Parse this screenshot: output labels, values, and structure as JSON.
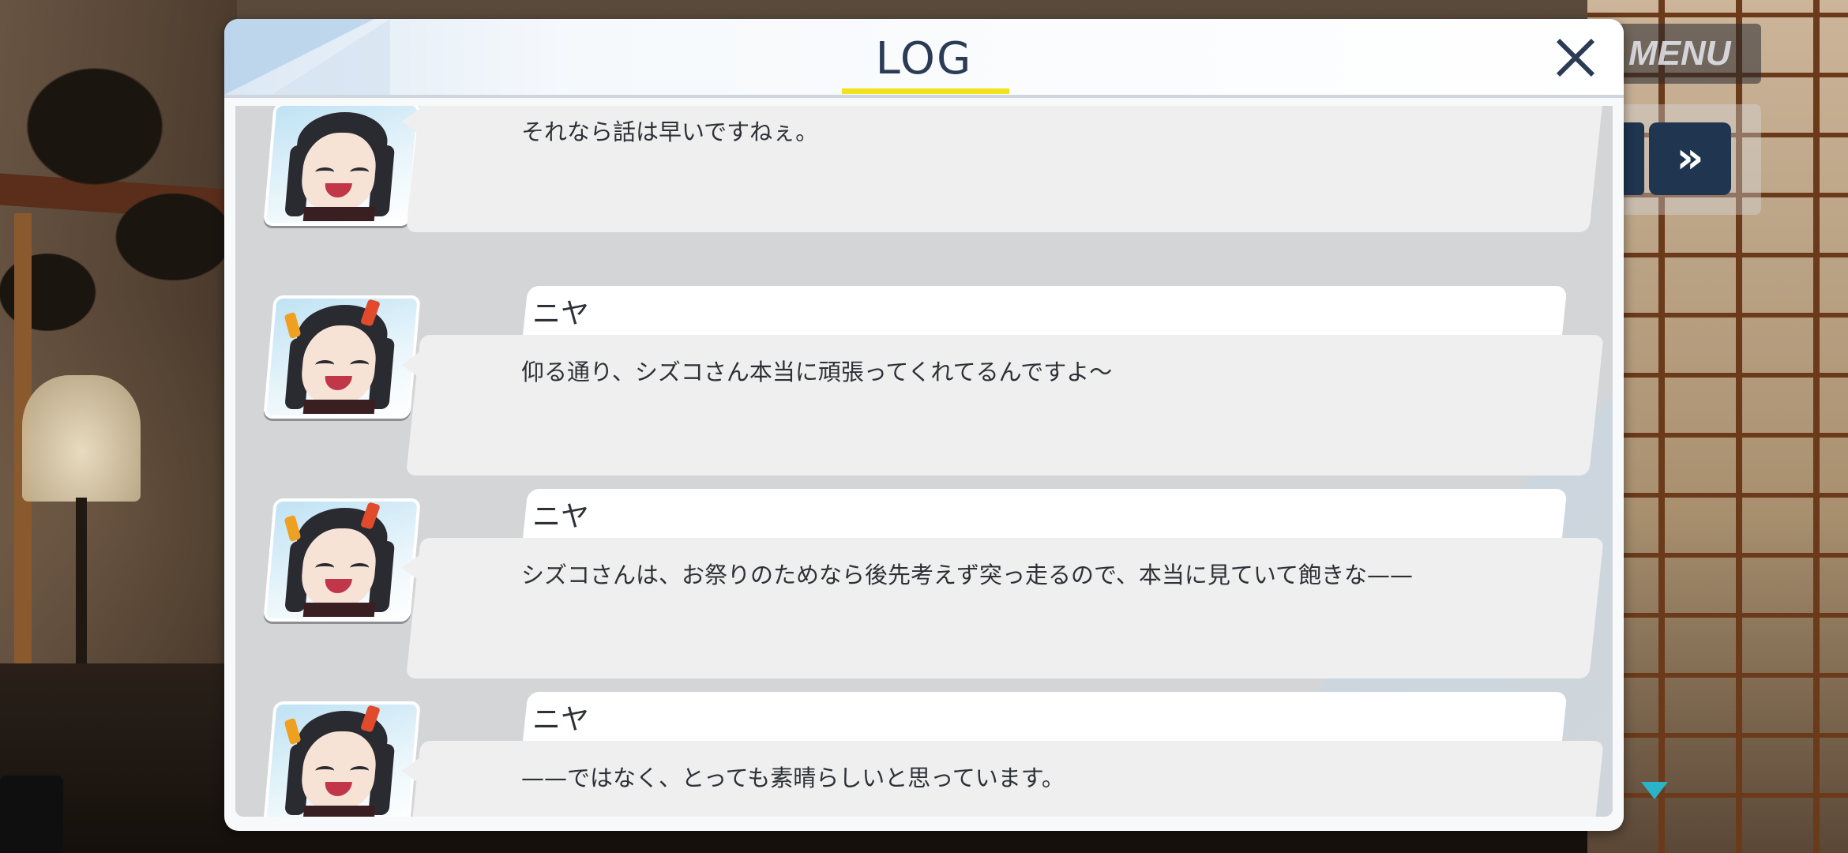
{
  "menu": {
    "label": "MENU"
  },
  "controls": {
    "skip_label": "»"
  },
  "log": {
    "title": "LOG",
    "accent_color": "#f1e21b",
    "close_icon": "close-icon",
    "entries": [
      {
        "speaker": "",
        "text": "それなら話は早いですねぇ。"
      },
      {
        "speaker": "ニヤ",
        "text": "仰る通り、シズコさん本当に頑張ってくれてるんですよ〜"
      },
      {
        "speaker": "ニヤ",
        "text": "シズコさんは、お祭りのためなら後先考えず突っ走るので、本当に見ていて飽きな——"
      },
      {
        "speaker": "ニヤ",
        "text": "——ではなく、とっても素晴らしいと思っています。"
      }
    ]
  },
  "scroll_indicator": {
    "icon": "triangle-down-icon",
    "color": "#2bb3c8"
  }
}
